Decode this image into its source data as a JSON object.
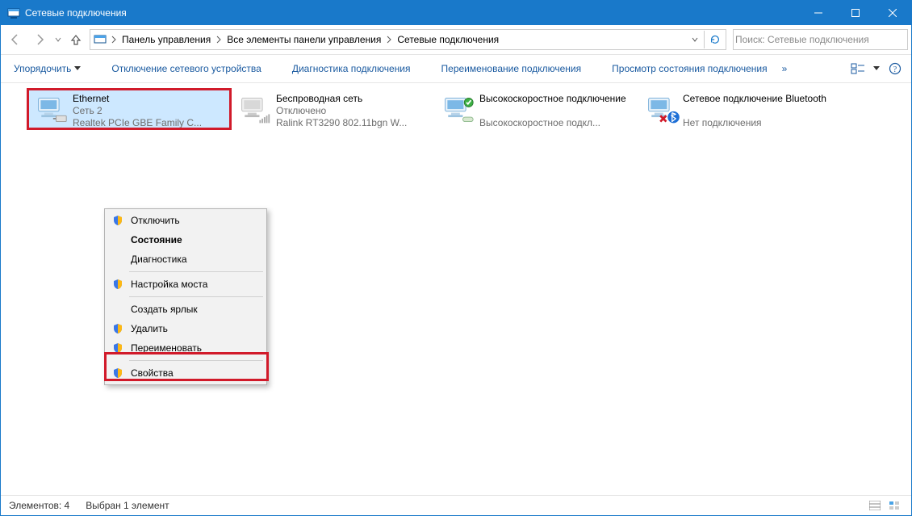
{
  "window": {
    "title": "Сетевые подключения"
  },
  "breadcrumbs": {
    "items": [
      "Панель управления",
      "Все элементы панели управления",
      "Сетевые подключения"
    ]
  },
  "search": {
    "placeholder": "Поиск: Сетевые подключения"
  },
  "commands": {
    "organize": "Упорядочить",
    "disable": "Отключение сетевого устройства",
    "diag": "Диагностика подключения",
    "rename": "Переименование подключения",
    "status": "Просмотр состояния подключения"
  },
  "connections": [
    {
      "name": "Ethernet",
      "sub1": "Сеть  2",
      "sub2": "Realtek PCIe GBE Family C..."
    },
    {
      "name": "Беспроводная сеть",
      "sub1": "Отключено",
      "sub2": "Ralink RT3290 802.11bgn W..."
    },
    {
      "name": "Высокоскоростное подключение",
      "sub1": "",
      "sub2": "Высокоскоростное подкл..."
    },
    {
      "name": "Сетевое подключение Bluetooth",
      "sub1": "",
      "sub2": "Нет подключения"
    }
  ],
  "context_menu": {
    "items": [
      {
        "label": "Отключить",
        "shield": true
      },
      {
        "label": "Состояние",
        "shield": false,
        "bold": true
      },
      {
        "label": "Диагностика",
        "shield": false
      },
      {
        "label": "Настройка моста",
        "shield": true
      },
      {
        "label": "Создать ярлык",
        "shield": false
      },
      {
        "label": "Удалить",
        "shield": true
      },
      {
        "label": "Переименовать",
        "shield": true
      },
      {
        "label": "Свойства",
        "shield": true
      }
    ]
  },
  "statusbar": {
    "count": "Элементов: 4",
    "selection": "Выбран 1 элемент"
  }
}
